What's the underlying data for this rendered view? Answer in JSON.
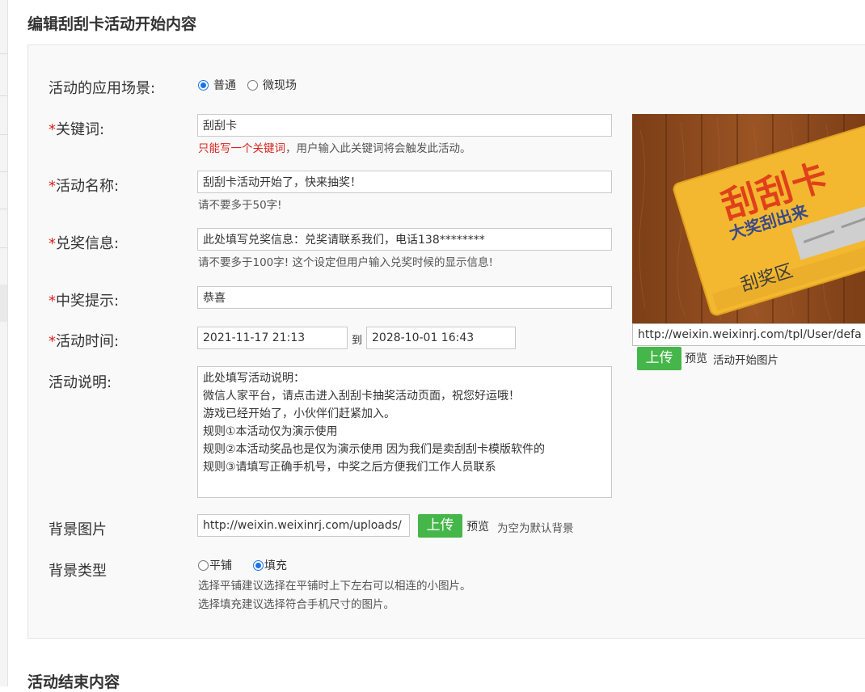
{
  "page": {
    "title": "编辑刮刮卡活动开始内容",
    "next_section_title": "活动结束内容"
  },
  "form": {
    "scene": {
      "label": "活动的应用场景:",
      "options": [
        "普通",
        "微现场"
      ],
      "selected": "普通"
    },
    "keyword": {
      "label": "关键词:",
      "required_mark": "*",
      "value": "刮刮卡",
      "hint_warning": "只能写一个关键词",
      "hint_rest": "，用户输入此关键词将会触发此活动。"
    },
    "name": {
      "label": "活动名称:",
      "required_mark": "*",
      "value": "刮刮卡活动开始了，快来抽奖！",
      "hint": "请不要多于50字!"
    },
    "prize_info": {
      "label": "兑奖信息:",
      "required_mark": "*",
      "value": "此处填写兑奖信息：兑奖请联系我们，电话138********",
      "hint": "请不要多于100字! 这个设定但用户输入兑奖时候的显示信息!"
    },
    "win_tip": {
      "label": "中奖提示:",
      "required_mark": "*",
      "value": "恭喜"
    },
    "time": {
      "label": "活动时间:",
      "required_mark": "*",
      "start": "2021-11-17 21:13",
      "to_label": "到",
      "end": "2028-10-01 16:43"
    },
    "description": {
      "label": "活动说明:",
      "value": "此处填写活动说明：\n微信人家平台，请点击进入刮刮卡抽奖活动页面，祝您好运哦！\n游戏已经开始了，小伙伴们赶紧加入。\n规则①本活动仅为演示使用\n规则②本活动奖品也是仅为演示使用 因为我们是卖刮刮卡模版软件的\n规则③请填写正确手机号，中奖之后方便我们工作人员联系"
    },
    "bg_image": {
      "label": "背景图片",
      "value": "http://weixin.weixinrj.com/uploads/",
      "upload_label": "上传",
      "preview_label": "预览",
      "note": "为空为默认背景"
    },
    "bg_type": {
      "label": "背景类型",
      "options": [
        "平铺",
        "填充"
      ],
      "selected": "填充",
      "hint_1": "选择平铺建议选择在平铺时上下左右可以相连的小图片。",
      "hint_2": "选择填充建议选择符合手机尺寸的图片。"
    }
  },
  "start_image": {
    "card_title": "刮刮卡",
    "card_subtitle": "大奖刮出来",
    "card_area": "刮奖区",
    "url": "http://weixin.weixinrj.com/tpl/User/defa",
    "upload_label": "上传",
    "preview_label": "预览",
    "caption": "活动开始图片"
  },
  "colors": {
    "required": "#d9231b",
    "button_green": "#45b649",
    "radio_blue": "#1a73e8",
    "card_yellow": "#f3b830",
    "wood": "#8a4a1c"
  }
}
